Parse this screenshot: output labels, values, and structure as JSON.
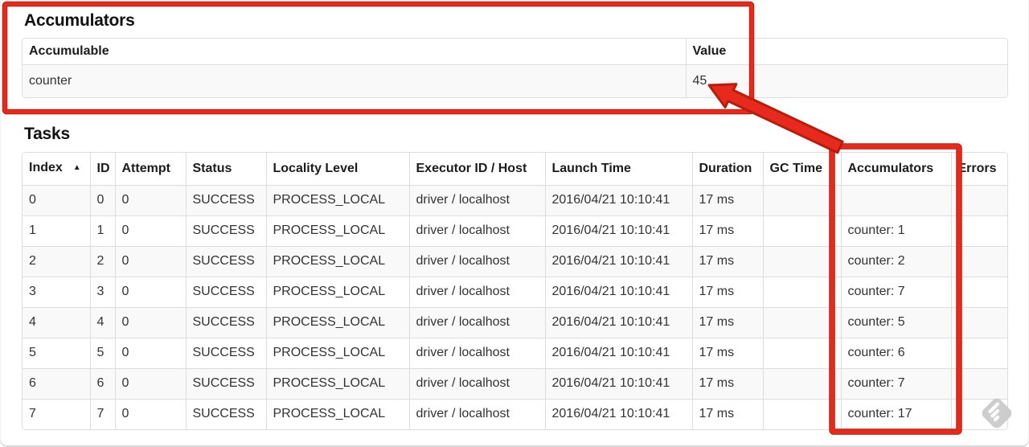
{
  "annotations": {
    "highlight_color": "#e8291d",
    "highlight_outline": "#b71d0c"
  },
  "watermark": {
    "icon": "stamp-icon",
    "color": "#cbcbcb"
  },
  "accumulators_section": {
    "heading": "Accumulators",
    "table": {
      "columns": [
        "Accumulable",
        "Value"
      ],
      "rows": [
        [
          "counter",
          "45"
        ]
      ]
    }
  },
  "tasks_section": {
    "heading": "Tasks",
    "table": {
      "sorted_column": "Index",
      "sort_icon": "▲",
      "columns": [
        "Index",
        "ID",
        "Attempt",
        "Status",
        "Locality Level",
        "Executor ID / Host",
        "Launch Time",
        "Duration",
        "GC Time",
        "Accumulators",
        "Errors"
      ],
      "rows": [
        [
          "0",
          "0",
          "0",
          "SUCCESS",
          "PROCESS_LOCAL",
          "driver / localhost",
          "2016/04/21 10:10:41",
          "17 ms",
          "",
          "",
          ""
        ],
        [
          "1",
          "1",
          "0",
          "SUCCESS",
          "PROCESS_LOCAL",
          "driver / localhost",
          "2016/04/21 10:10:41",
          "17 ms",
          "",
          "counter: 1",
          ""
        ],
        [
          "2",
          "2",
          "0",
          "SUCCESS",
          "PROCESS_LOCAL",
          "driver / localhost",
          "2016/04/21 10:10:41",
          "17 ms",
          "",
          "counter: 2",
          ""
        ],
        [
          "3",
          "3",
          "0",
          "SUCCESS",
          "PROCESS_LOCAL",
          "driver / localhost",
          "2016/04/21 10:10:41",
          "17 ms",
          "",
          "counter: 7",
          ""
        ],
        [
          "4",
          "4",
          "0",
          "SUCCESS",
          "PROCESS_LOCAL",
          "driver / localhost",
          "2016/04/21 10:10:41",
          "17 ms",
          "",
          "counter: 5",
          ""
        ],
        [
          "5",
          "5",
          "0",
          "SUCCESS",
          "PROCESS_LOCAL",
          "driver / localhost",
          "2016/04/21 10:10:41",
          "17 ms",
          "",
          "counter: 6",
          ""
        ],
        [
          "6",
          "6",
          "0",
          "SUCCESS",
          "PROCESS_LOCAL",
          "driver / localhost",
          "2016/04/21 10:10:41",
          "17 ms",
          "",
          "counter: 7",
          ""
        ],
        [
          "7",
          "7",
          "0",
          "SUCCESS",
          "PROCESS_LOCAL",
          "driver / localhost",
          "2016/04/21 10:10:41",
          "17 ms",
          "",
          "counter: 17",
          ""
        ]
      ]
    }
  }
}
